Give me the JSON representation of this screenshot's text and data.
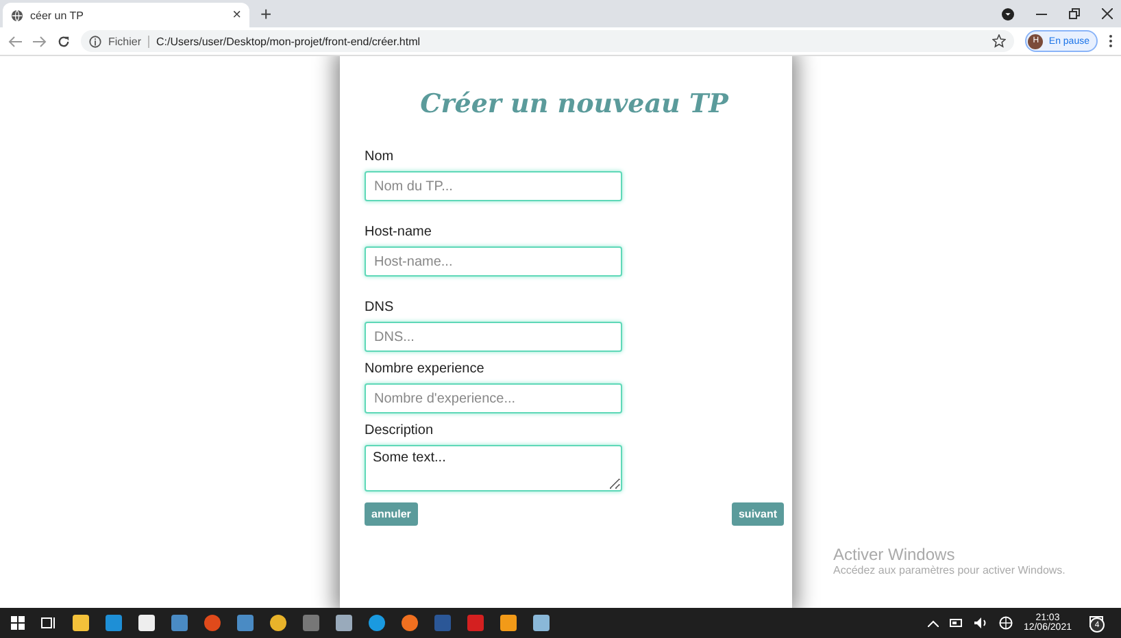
{
  "browser": {
    "tab_title": "céer un TP",
    "close_symbol": "×",
    "new_tab_symbol": "+",
    "address_prefix": "Fichier",
    "address": "C:/Users/user/Desktop/mon-projet/front-end/créer.html",
    "profile_initial": "H",
    "profile_status": "En pause"
  },
  "form": {
    "title": "Créer un nouveau TP",
    "fields": [
      {
        "label": "Nom",
        "placeholder": "Nom du TP...",
        "kind": "input"
      },
      {
        "label": "Host-name",
        "placeholder": "Host-name...",
        "kind": "input"
      },
      {
        "label": "DNS",
        "placeholder": "DNS...",
        "kind": "input"
      },
      {
        "label": "Nombre experience",
        "placeholder": "Nombre d'experience...",
        "kind": "input"
      },
      {
        "label": "Description",
        "placeholder": "Some text...",
        "kind": "textarea"
      }
    ],
    "buttons": [
      "annuler",
      "suivant"
    ]
  },
  "activation_notice": {
    "title": "Activer Windows",
    "text": "Accédez aux paramètres pour activer Windows."
  },
  "taskbar": {
    "time": "21:03",
    "date": "12/06/2021",
    "notification_count": "4"
  }
}
